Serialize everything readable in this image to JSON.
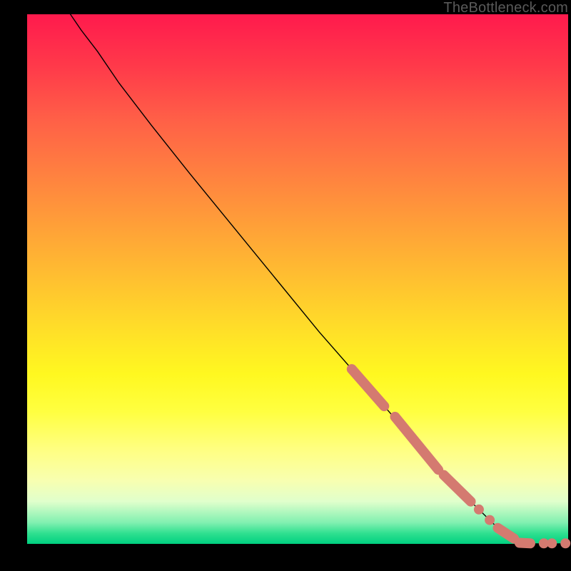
{
  "watermark": "TheBottleneck.com",
  "colors": {
    "curve": "#000000",
    "marker": "#d47a70",
    "bg_frame": "#000000"
  },
  "chart_data": {
    "type": "line",
    "title": "",
    "xlabel": "",
    "ylabel": "",
    "xlim": [
      0,
      100
    ],
    "ylim": [
      0,
      100
    ],
    "grid": false,
    "legend": false,
    "series": [
      {
        "name": "curve",
        "x": [
          8,
          10,
          13,
          17,
          23,
          30,
          38,
          46,
          54,
          60,
          66,
          72,
          78,
          84,
          88,
          91,
          93,
          95,
          98,
          100
        ],
        "y": [
          100,
          97,
          93,
          87,
          79,
          70,
          60,
          50,
          40,
          33,
          26,
          19,
          12,
          6,
          2,
          0.5,
          0,
          0,
          0,
          0
        ]
      }
    ],
    "markers": [
      {
        "name": "thick-segment-1",
        "shape": "segment",
        "x0": 60,
        "y0": 33,
        "x1": 66,
        "y1": 26
      },
      {
        "name": "thick-segment-2",
        "shape": "segment",
        "x0": 68,
        "y0": 24,
        "x1": 76,
        "y1": 14
      },
      {
        "name": "thick-segment-3",
        "shape": "segment",
        "x0": 77,
        "y0": 13,
        "x1": 82,
        "y1": 8
      },
      {
        "name": "dot-1",
        "shape": "dot",
        "x": 83.5,
        "y": 6.5
      },
      {
        "name": "dot-2",
        "shape": "dot",
        "x": 85.5,
        "y": 4.5
      },
      {
        "name": "thick-segment-4",
        "shape": "segment",
        "x0": 87,
        "y0": 3,
        "x1": 90,
        "y1": 1
      },
      {
        "name": "thick-segment-5",
        "shape": "segment",
        "x0": 91,
        "y0": 0.2,
        "x1": 93,
        "y1": 0.1
      },
      {
        "name": "dot-3",
        "shape": "dot",
        "x": 95.5,
        "y": 0.1
      },
      {
        "name": "dot-4",
        "shape": "dot",
        "x": 97,
        "y": 0.1
      },
      {
        "name": "dot-5",
        "shape": "dot",
        "x": 99.5,
        "y": 0.1
      }
    ]
  }
}
